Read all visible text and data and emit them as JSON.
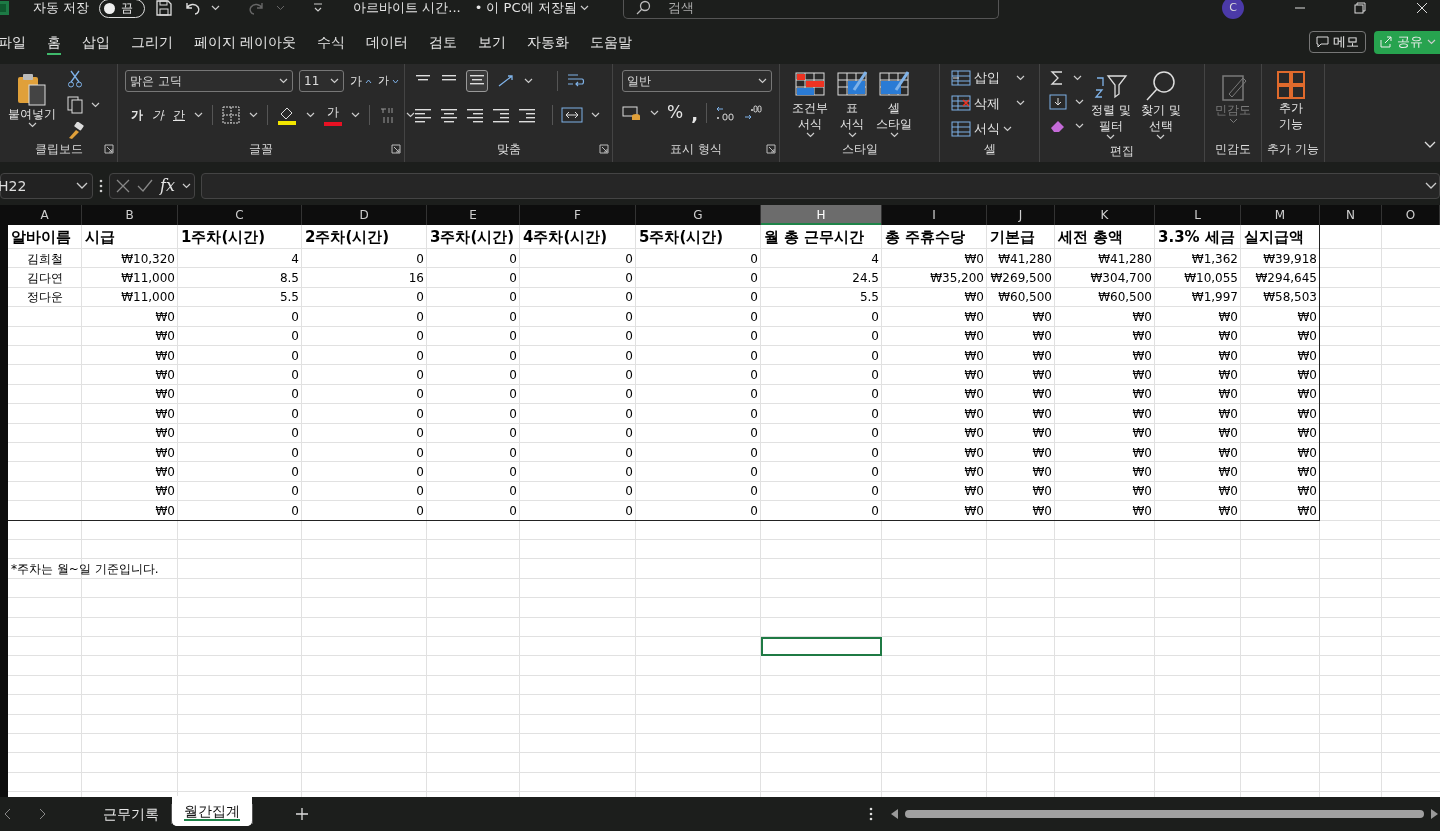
{
  "title_bar": {
    "autosave_label": "자동 저장",
    "autosave_on": false,
    "autosave_state": "끔",
    "file_title": "아르바이트 시간...",
    "save_status": "• 이 PC에 저장됨",
    "search_placeholder": "검색",
    "avatar": "C"
  },
  "menu_tabs": [
    {
      "label": "파일",
      "selected": false
    },
    {
      "label": "홈",
      "selected": true
    },
    {
      "label": "삽입",
      "selected": false
    },
    {
      "label": "그리기",
      "selected": false
    },
    {
      "label": "페이지 레이아웃",
      "selected": false
    },
    {
      "label": "수식",
      "selected": false
    },
    {
      "label": "데이터",
      "selected": false
    },
    {
      "label": "검토",
      "selected": false
    },
    {
      "label": "보기",
      "selected": false
    },
    {
      "label": "자동화",
      "selected": false
    },
    {
      "label": "도움말",
      "selected": false
    }
  ],
  "memo_button": "메모",
  "share_button": "공유",
  "ribbon": {
    "clipboard": {
      "paste": "붙여넣기",
      "label": "클립보드"
    },
    "font": {
      "face": "맑은 고딕",
      "size": "11",
      "grow": "가",
      "shrink": "가",
      "bold": "가",
      "italic": "가",
      "underline": "간",
      "font_color": "가",
      "label": "글꼴"
    },
    "alignment": {
      "label": "맞춤"
    },
    "number": {
      "format": "일반",
      "percent": "%",
      "comma": ",",
      "label": "표시 형식"
    },
    "styles": {
      "conditional": [
        "조건부",
        "서식"
      ],
      "table": [
        "표",
        "서식"
      ],
      "cell": [
        "셀",
        "스타일"
      ],
      "label": "스타일"
    },
    "cells": {
      "insert": "삽입",
      "delete": "삭제",
      "format": "서식",
      "label": "셀"
    },
    "editing": {
      "sort": [
        "정렬 및",
        "필터"
      ],
      "find": [
        "찾기 및",
        "선택"
      ],
      "label": "편집"
    },
    "sensitivity": {
      "button": "민감도",
      "disabled": true,
      "label": "민감도"
    },
    "addins": {
      "button": [
        "추가",
        "기능"
      ],
      "label": "추가 기능"
    }
  },
  "formula_bar": {
    "name_box": "H22",
    "fx": "fx"
  },
  "sheet": {
    "columns": [
      {
        "letter": "A",
        "selected": false
      },
      {
        "letter": "B",
        "selected": false
      },
      {
        "letter": "C",
        "selected": false
      },
      {
        "letter": "D",
        "selected": false
      },
      {
        "letter": "E",
        "selected": false
      },
      {
        "letter": "F",
        "selected": false
      },
      {
        "letter": "G",
        "selected": false
      },
      {
        "letter": "H",
        "selected": true
      },
      {
        "letter": "I",
        "selected": false
      },
      {
        "letter": "J",
        "selected": false
      },
      {
        "letter": "K",
        "selected": false
      },
      {
        "letter": "L",
        "selected": false
      },
      {
        "letter": "M",
        "selected": false
      },
      {
        "letter": "N",
        "selected": false
      },
      {
        "letter": "O",
        "selected": false
      }
    ],
    "header_row": [
      "알바이름",
      "시급",
      "1주차(시간)",
      "2주차(시간)",
      "3주차(시간)",
      "4주차(시간)",
      "5주차(시간)",
      "월 총 근무시간",
      "총 주휴수당",
      "기본급",
      "세전 총액",
      "3.3% 세금",
      "실지급액"
    ],
    "rows": [
      {
        "name": "김희철",
        "values": [
          "₩10,320",
          "4",
          "0",
          "0",
          "0",
          "0",
          "4",
          "₩0",
          "₩41,280",
          "₩41,280",
          "₩1,362",
          "₩39,918"
        ],
        "active": false
      },
      {
        "name": "김다연",
        "values": [
          "₩11,000",
          "8.5",
          "16",
          "0",
          "0",
          "0",
          "24.5",
          "₩35,200",
          "₩269,500",
          "₩304,700",
          "₩10,055",
          "₩294,645"
        ],
        "active": false
      },
      {
        "name": "정다운",
        "values": [
          "₩11,000",
          "5.5",
          "0",
          "0",
          "0",
          "0",
          "5.5",
          "₩0",
          "₩60,500",
          "₩60,500",
          "₩1,997",
          "₩58,503"
        ],
        "active": false
      },
      {
        "values": [
          "₩0",
          "0",
          "0",
          "0",
          "0",
          "0",
          "0",
          "₩0",
          "₩0",
          "₩0",
          "₩0",
          "₩0"
        ],
        "active": false
      },
      {
        "values": [
          "₩0",
          "0",
          "0",
          "0",
          "0",
          "0",
          "0",
          "₩0",
          "₩0",
          "₩0",
          "₩0",
          "₩0"
        ],
        "active": false
      },
      {
        "values": [
          "₩0",
          "0",
          "0",
          "0",
          "0",
          "0",
          "0",
          "₩0",
          "₩0",
          "₩0",
          "₩0",
          "₩0"
        ],
        "active": false
      },
      {
        "values": [
          "₩0",
          "0",
          "0",
          "0",
          "0",
          "0",
          "0",
          "₩0",
          "₩0",
          "₩0",
          "₩0",
          "₩0"
        ],
        "active": false
      },
      {
        "values": [
          "₩0",
          "0",
          "0",
          "0",
          "0",
          "0",
          "0",
          "₩0",
          "₩0",
          "₩0",
          "₩0",
          "₩0"
        ],
        "active": false
      },
      {
        "values": [
          "₩0",
          "0",
          "0",
          "0",
          "0",
          "0",
          "0",
          "₩0",
          "₩0",
          "₩0",
          "₩0",
          "₩0"
        ],
        "active": false
      },
      {
        "values": [
          "₩0",
          "0",
          "0",
          "0",
          "0",
          "0",
          "0",
          "₩0",
          "₩0",
          "₩0",
          "₩0",
          "₩0"
        ],
        "active": false
      },
      {
        "values": [
          "₩0",
          "0",
          "0",
          "0",
          "0",
          "0",
          "0",
          "₩0",
          "₩0",
          "₩0",
          "₩0",
          "₩0"
        ],
        "active": false
      },
      {
        "values": [
          "₩0",
          "0",
          "0",
          "0",
          "0",
          "0",
          "0",
          "₩0",
          "₩0",
          "₩0",
          "₩0",
          "₩0"
        ],
        "active": false
      },
      {
        "values": [
          "₩0",
          "0",
          "0",
          "0",
          "0",
          "0",
          "0",
          "₩0",
          "₩0",
          "₩0",
          "₩0",
          "₩0"
        ],
        "active": false
      },
      {
        "values": [
          "₩0",
          "0",
          "0",
          "0",
          "0",
          "0",
          "0",
          "₩0",
          "₩0",
          "₩0",
          "₩0",
          "₩0"
        ],
        "active": false
      },
      {
        "active": false
      },
      {
        "active": false
      },
      {
        "note": "*주차는 월~일 기준입니다.",
        "active": false
      },
      {
        "active": false
      },
      {
        "active": false
      },
      {
        "active": false
      },
      {
        "active": true
      },
      {
        "active": false
      },
      {
        "active": false
      },
      {
        "active": false
      },
      {
        "active": false
      },
      {
        "active": false
      },
      {
        "active": false
      },
      {
        "active": false
      }
    ]
  },
  "sheet_tabs": [
    {
      "label": "근무기록",
      "selected": false
    },
    {
      "label": "월간집계",
      "selected": true
    }
  ]
}
